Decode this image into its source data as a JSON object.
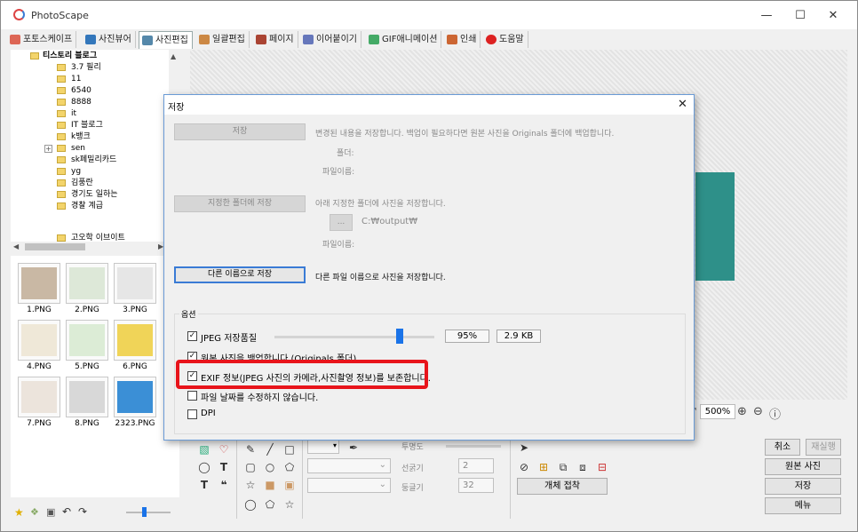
{
  "app": {
    "title": "PhotoScape"
  },
  "window_controls": {
    "minimize": "—",
    "maximize": "☐",
    "close": "✕"
  },
  "tabs": [
    {
      "label": "포토스케이프",
      "color": "#d65"
    },
    {
      "label": "사진뷰어",
      "color": "#37b"
    },
    {
      "label": "사진편집",
      "color": "#58a"
    },
    {
      "label": "일괄편집",
      "color": "#c84"
    },
    {
      "label": "페이지",
      "color": "#a43"
    },
    {
      "label": "이어붙이기",
      "color": "#67b"
    },
    {
      "label": "GIF애니메이션",
      "color": "#4a6"
    },
    {
      "label": "인쇄",
      "color": "#c63"
    },
    {
      "label": "도움말",
      "color": "#d22"
    }
  ],
  "tree": {
    "root": "티스토리 블로그",
    "items": [
      "3.7 필리",
      "11",
      "6540",
      "8888",
      "it",
      "IT 블로그",
      "k뱅크",
      "sen",
      "sk페밀리카드",
      "yg",
      "김풍란",
      "경기도 일하는",
      "경찰 계급",
      "고오학 이브이트"
    ]
  },
  "thumbnails": [
    {
      "label": "1.PNG",
      "color": "#c9b8a4"
    },
    {
      "label": "2.PNG",
      "color": "#dde8d8"
    },
    {
      "label": "3.PNG",
      "color": "#e6e6e6"
    },
    {
      "label": "4.PNG",
      "color": "#efe8d8"
    },
    {
      "label": "5.PNG",
      "color": "#dcecd6"
    },
    {
      "label": "6.PNG",
      "color": "#f0d458"
    },
    {
      "label": "7.PNG",
      "color": "#ece4dc"
    },
    {
      "label": "8.PNG",
      "color": "#d8d8d8"
    },
    {
      "label": "2323.PNG",
      "color": "#3b8fd6"
    }
  ],
  "dialog": {
    "title": "저장",
    "save_button": "저장",
    "save_desc": "변경된 내용을 저장합니다. 백업이 필요하다면 원본 사진을 Originals 폴더에 백업합니다.",
    "folder_label": "폴더:",
    "filename_label": "파일이름:",
    "save_to_folder_button": "지정한 폴더에 저장",
    "save_to_folder_desc": "아래 지정한 폴더에 사진을 저장합니다.",
    "browse_button": "...",
    "output_path": "C:₩output₩",
    "filename_label2": "파일이름:",
    "save_as_button": "다른 이름으로 저장",
    "save_as_desc": "다른 파일 이름으로 사진을 저장합니다.",
    "options_label": "옵션",
    "jpeg_quality_label": "JPEG 저장품질",
    "jpeg_quality_value": "95%",
    "jpeg_quality_fraction": 0.95,
    "file_size": "2.9 KB",
    "backup_label": "원본 사진을 백업합니다 (Originals 폴더)",
    "exif_label": "EXIF 정보(JPEG 사진의 카메라,사진촬영 정보)를 보존합니다.",
    "keep_date_label": "파일 날짜를 수정하지 않습니다.",
    "dpi_label": "DPI",
    "checks": {
      "jpeg": true,
      "backup": true,
      "exif": true,
      "keep_date": false,
      "dpi": false
    },
    "highlight_color": "#e8141b"
  },
  "zoom": {
    "value": "500%"
  },
  "tool_panel": {
    "opacity_label": "투명도",
    "line_width_label": "선굵기",
    "line_width_value": "2",
    "round_label": "둥글기",
    "round_value": "32",
    "crop_button": "개체 접착"
  },
  "right_buttons": {
    "cancel": "취소",
    "redo": "재실행",
    "original": "원본 사진",
    "save": "저장",
    "menu": "메뉴"
  },
  "colors": {
    "accent_teal": "#2e9089",
    "dialog_border": "#6a9bd6"
  }
}
